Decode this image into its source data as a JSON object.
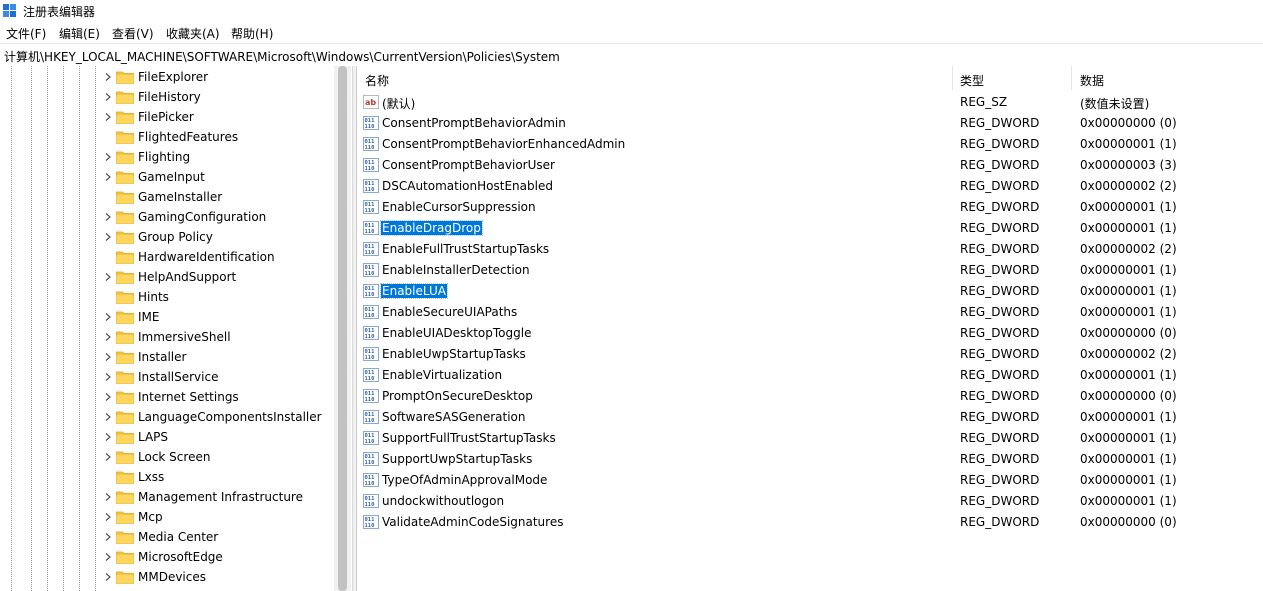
{
  "window": {
    "title": "注册表编辑器"
  },
  "menu": [
    "文件(F)",
    "编辑(E)",
    "查看(V)",
    "收藏夹(A)",
    "帮助(H)"
  ],
  "address": "计算机\\HKEY_LOCAL_MACHINE\\SOFTWARE\\Microsoft\\Windows\\CurrentVersion\\Policies\\System",
  "tree": [
    {
      "label": "FileExplorer",
      "expandable": true
    },
    {
      "label": "FileHistory",
      "expandable": true
    },
    {
      "label": "FilePicker",
      "expandable": true
    },
    {
      "label": "FlightedFeatures",
      "expandable": false
    },
    {
      "label": "Flighting",
      "expandable": true
    },
    {
      "label": "GameInput",
      "expandable": true
    },
    {
      "label": "GameInstaller",
      "expandable": false
    },
    {
      "label": "GamingConfiguration",
      "expandable": true
    },
    {
      "label": "Group Policy",
      "expandable": true
    },
    {
      "label": "HardwareIdentification",
      "expandable": false
    },
    {
      "label": "HelpAndSupport",
      "expandable": true
    },
    {
      "label": "Hints",
      "expandable": false
    },
    {
      "label": "IME",
      "expandable": true
    },
    {
      "label": "ImmersiveShell",
      "expandable": true
    },
    {
      "label": "Installer",
      "expandable": true
    },
    {
      "label": "InstallService",
      "expandable": true
    },
    {
      "label": "Internet Settings",
      "expandable": true
    },
    {
      "label": "LanguageComponentsInstaller",
      "expandable": true
    },
    {
      "label": "LAPS",
      "expandable": true
    },
    {
      "label": "Lock Screen",
      "expandable": true
    },
    {
      "label": "Lxss",
      "expandable": false
    },
    {
      "label": "Management Infrastructure",
      "expandable": true
    },
    {
      "label": "Mcp",
      "expandable": true
    },
    {
      "label": "Media Center",
      "expandable": true
    },
    {
      "label": "MicrosoftEdge",
      "expandable": true
    },
    {
      "label": "MMDevices",
      "expandable": true
    }
  ],
  "columns": {
    "name": "名称",
    "type": "类型",
    "data": "数据"
  },
  "values": [
    {
      "name": "(默认)",
      "type": "REG_SZ",
      "data": "(数值未设置)",
      "icon": "string-value-icon",
      "selected": false
    },
    {
      "name": "ConsentPromptBehaviorAdmin",
      "type": "REG_DWORD",
      "data": "0x00000000 (0)",
      "icon": "dword-value-icon",
      "selected": false
    },
    {
      "name": "ConsentPromptBehaviorEnhancedAdmin",
      "type": "REG_DWORD",
      "data": "0x00000001 (1)",
      "icon": "dword-value-icon",
      "selected": false
    },
    {
      "name": "ConsentPromptBehaviorUser",
      "type": "REG_DWORD",
      "data": "0x00000003 (3)",
      "icon": "dword-value-icon",
      "selected": false
    },
    {
      "name": "DSCAutomationHostEnabled",
      "type": "REG_DWORD",
      "data": "0x00000002 (2)",
      "icon": "dword-value-icon",
      "selected": false
    },
    {
      "name": "EnableCursorSuppression",
      "type": "REG_DWORD",
      "data": "0x00000001 (1)",
      "icon": "dword-value-icon",
      "selected": false
    },
    {
      "name": "EnableDragDrop",
      "type": "REG_DWORD",
      "data": "0x00000001 (1)",
      "icon": "dword-value-icon",
      "selected": true
    },
    {
      "name": "EnableFullTrustStartupTasks",
      "type": "REG_DWORD",
      "data": "0x00000002 (2)",
      "icon": "dword-value-icon",
      "selected": false
    },
    {
      "name": "EnableInstallerDetection",
      "type": "REG_DWORD",
      "data": "0x00000001 (1)",
      "icon": "dword-value-icon",
      "selected": false
    },
    {
      "name": "EnableLUA",
      "type": "REG_DWORD",
      "data": "0x00000001 (1)",
      "icon": "dword-value-icon",
      "selected": true
    },
    {
      "name": "EnableSecureUIAPaths",
      "type": "REG_DWORD",
      "data": "0x00000001 (1)",
      "icon": "dword-value-icon",
      "selected": false
    },
    {
      "name": "EnableUIADesktopToggle",
      "type": "REG_DWORD",
      "data": "0x00000000 (0)",
      "icon": "dword-value-icon",
      "selected": false
    },
    {
      "name": "EnableUwpStartupTasks",
      "type": "REG_DWORD",
      "data": "0x00000002 (2)",
      "icon": "dword-value-icon",
      "selected": false
    },
    {
      "name": "EnableVirtualization",
      "type": "REG_DWORD",
      "data": "0x00000001 (1)",
      "icon": "dword-value-icon",
      "selected": false
    },
    {
      "name": "PromptOnSecureDesktop",
      "type": "REG_DWORD",
      "data": "0x00000000 (0)",
      "icon": "dword-value-icon",
      "selected": false
    },
    {
      "name": "SoftwareSASGeneration",
      "type": "REG_DWORD",
      "data": "0x00000001 (1)",
      "icon": "dword-value-icon",
      "selected": false
    },
    {
      "name": "SupportFullTrustStartupTasks",
      "type": "REG_DWORD",
      "data": "0x00000001 (1)",
      "icon": "dword-value-icon",
      "selected": false
    },
    {
      "name": "SupportUwpStartupTasks",
      "type": "REG_DWORD",
      "data": "0x00000001 (1)",
      "icon": "dword-value-icon",
      "selected": false
    },
    {
      "name": "TypeOfAdminApprovalMode",
      "type": "REG_DWORD",
      "data": "0x00000001 (1)",
      "icon": "dword-value-icon",
      "selected": false
    },
    {
      "name": "undockwithoutlogon",
      "type": "REG_DWORD",
      "data": "0x00000001 (1)",
      "icon": "dword-value-icon",
      "selected": false
    },
    {
      "name": "ValidateAdminCodeSignatures",
      "type": "REG_DWORD",
      "data": "0x00000000 (0)",
      "icon": "dword-value-icon",
      "selected": false
    }
  ],
  "colors": {
    "selection": "#0078d7",
    "folder": "#f5c342",
    "dword_icon": "#2f5fb3",
    "string_icon": "#c0392b"
  }
}
